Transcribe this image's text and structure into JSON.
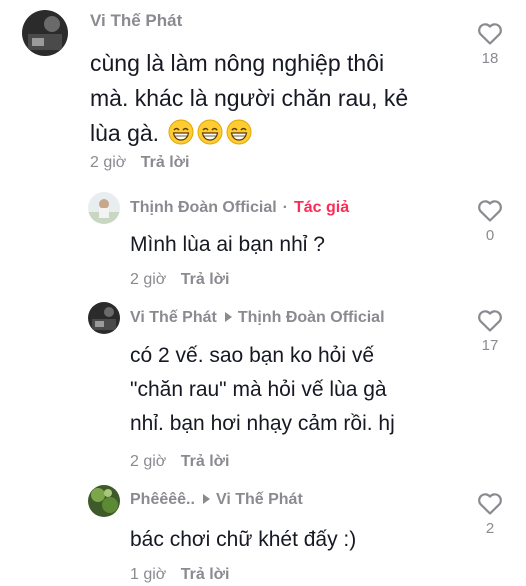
{
  "comments": [
    {
      "username": "Vi Thế Phát",
      "text_lines": [
        "cùng là làm nông nghiệp thôi",
        "mà. khác là người chăn rau, kẻ",
        "lùa gà."
      ],
      "emojis": [
        "grinning-face",
        "grinning-face",
        "grinning-face"
      ],
      "time": "2 giờ",
      "reply_label": "Trả lời",
      "likes": "18"
    },
    {
      "username": "Thịnh Đoàn Official",
      "separator": "·",
      "badge": "Tác giả",
      "text": "Mình lùa ai bạn nhỉ ?",
      "time": "2 giờ",
      "reply_label": "Trả lời",
      "likes": "0"
    },
    {
      "username": "Vi Thế Phát",
      "reply_to": "Thịnh Đoàn Official",
      "text_lines": [
        "có 2 vế. sao bạn ko hỏi vế",
        "\"chăn rau\" mà hỏi vế lùa gà",
        "nhỉ. bạn hơi nhạy cảm rồi. hj"
      ],
      "time": "2 giờ",
      "reply_label": "Trả lời",
      "likes": "17"
    },
    {
      "username": "Phêêêê..",
      "reply_to": "Vi Thế Phát",
      "text": "bác chơi chữ khét đấy :)",
      "time": "1 giờ",
      "reply_label": "Trả lời",
      "likes": "2"
    }
  ],
  "icons": {
    "like": "heart-outline-icon",
    "reply_arrow": "triangle-right-icon"
  },
  "colors": {
    "text": "#161823",
    "muted": "#8a8b91",
    "author_badge": "#fe2c55"
  }
}
